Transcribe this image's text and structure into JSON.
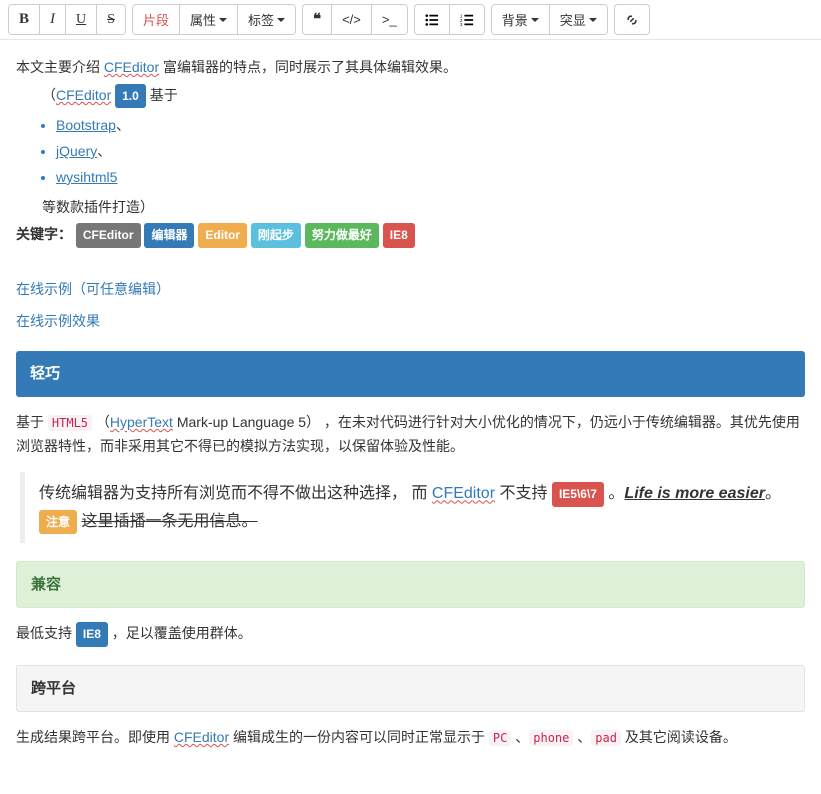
{
  "toolbar": {
    "bold": "B",
    "italic": "I",
    "underline": "U",
    "strike": "S",
    "segment": "片段",
    "attrs": "属性",
    "tag": "标签",
    "bg": "背景",
    "hl": "突显"
  },
  "intro": {
    "line1_a": "本文主要介绍 ",
    "line1_link": "CFEditor",
    "line1_b": " 富编辑器的特点，同时展示了其具体编辑效果。",
    "paren_open": "（",
    "badge_ver": "1.0",
    "based": " 基于",
    "paren_close": "等数款插件打造）"
  },
  "libs": {
    "a": "Bootstrap",
    "b": "jQuery",
    "c": "wysihtml5",
    "sep": "、"
  },
  "kw": {
    "label": "关键字：",
    "t1": "CFEditor",
    "t2": "编辑器",
    "t3": "Editor",
    "t4": "刚起步",
    "t5": "努力做最好",
    "t6": "IE8"
  },
  "toc": {
    "a": "在线示例（可任意编辑）",
    "b": "在线示例效果"
  },
  "s1": {
    "title": "轻巧",
    "p1a": "基于 ",
    "code": "HTML5",
    "p1b": " （",
    "link": "HyperText",
    "p1c": " Mark-up Language 5） ，在未对代码进行针对大小优化的情况下，仍远小于传统编辑器。其优先使用浏览器特性，而非采用其它不得已的模拟方法实现，以保留体验及性能。",
    "bq_a": "传统编辑器为支持所有浏览而不得不做出这种选择， 而 ",
    "bq_link": "CFEditor",
    "bq_b": " 不支持 ",
    "bq_badge": "IE5\\6\\7",
    "bq_c": " 。",
    "bq_em": "Life is more easier",
    "bq_d": "。",
    "note_badge": "注意",
    "note_strike": "这里插播一条无用信息。"
  },
  "s2": {
    "title": "兼容",
    "p1a": "最低支持 ",
    "badge": "IE8",
    "p1b": " ，足以覆盖使用群体。"
  },
  "s3": {
    "title": "跨平台",
    "p1a": "生成结果跨平台。即使用 ",
    "link": "CFEditor",
    "p1b": " 编辑成生的一份内容可以同时正常显示于 ",
    "c1": "PC",
    "c2": "phone",
    "c3": "pad",
    "sep": " 、",
    "p1c": " 及其它阅读设备。"
  }
}
